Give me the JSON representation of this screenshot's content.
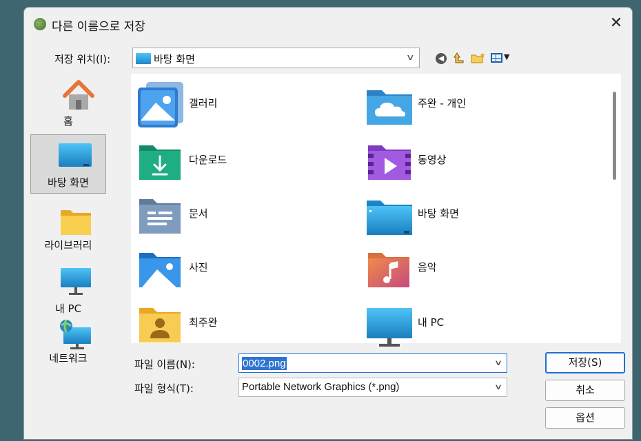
{
  "dialog": {
    "title": "다른 이름으로 저장",
    "close_glyph": "✕"
  },
  "location": {
    "label": "저장 위치(I):",
    "value": "바탕 화면",
    "icon": "desktop-folder-icon"
  },
  "toolbar": {
    "icons": [
      "back-icon",
      "up-folder-icon",
      "new-folder-icon",
      "view-menu-icon"
    ]
  },
  "places": [
    {
      "label": "홈",
      "icon": "home-icon",
      "selected": false
    },
    {
      "label": "바탕 화면",
      "icon": "desktop-icon",
      "selected": true
    },
    {
      "label": "라이브러리",
      "icon": "library-folder-icon",
      "selected": false
    },
    {
      "label": "내 PC",
      "icon": "computer-icon",
      "selected": false
    },
    {
      "label": "네트워크",
      "icon": "network-icon",
      "selected": false
    }
  ],
  "files": [
    {
      "label": "갤러리",
      "icon": "gallery-icon"
    },
    {
      "label": "주완 - 개인",
      "icon": "onedrive-folder-icon"
    },
    {
      "label": "다운로드",
      "icon": "downloads-folder-icon"
    },
    {
      "label": "동영상",
      "icon": "videos-folder-icon"
    },
    {
      "label": "문서",
      "icon": "documents-folder-icon"
    },
    {
      "label": "바탕 화면",
      "icon": "desktop-folder-icon"
    },
    {
      "label": "사진",
      "icon": "pictures-folder-icon"
    },
    {
      "label": "음악",
      "icon": "music-folder-icon"
    },
    {
      "label": "최주완",
      "icon": "user-folder-icon"
    },
    {
      "label": "내 PC",
      "icon": "computer-icon"
    }
  ],
  "filename": {
    "label": "파일 이름(N):",
    "value": "0002.png"
  },
  "filetype": {
    "label": "파일 형식(T):",
    "value": "Portable Network Graphics (*.png)"
  },
  "buttons": {
    "save": "저장(S)",
    "cancel": "취소",
    "options": "옵션"
  },
  "colors": {
    "accent": "#1f6fd1",
    "background": "#3d6670"
  }
}
